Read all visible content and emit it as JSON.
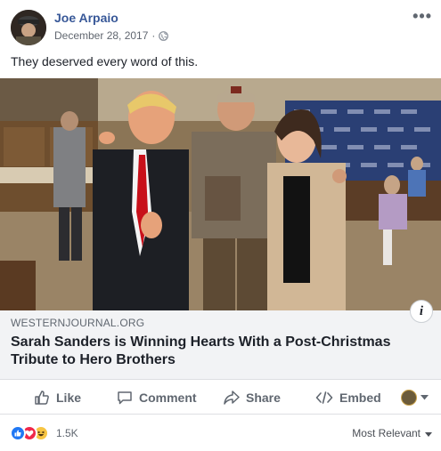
{
  "post": {
    "author": "Joe Arpaio",
    "date": "December 28, 2017",
    "separator": "·",
    "text": "They deserved every word of this.",
    "icons": {
      "more": "more-options-icon",
      "audience": "globe-icon"
    }
  },
  "link": {
    "domain": "WESTERNJOURNAL.ORG",
    "title": "Sarah Sanders is Winning Hearts With a Post-Christmas Tribute to Hero Brothers",
    "info_glyph": "i"
  },
  "actions": {
    "like": "Like",
    "comment": "Comment",
    "share": "Share",
    "embed": "Embed"
  },
  "footer": {
    "reaction_icons": [
      "like-reaction-icon",
      "love-reaction-icon",
      "haha-reaction-icon"
    ],
    "reaction_count": "1.5K",
    "sort_label": "Most Relevant"
  },
  "colors": {
    "link_blue": "#385898",
    "secondary_text": "#606770",
    "preview_bg": "#f2f3f5",
    "like_blue": "#2078f4",
    "love_red": "#f0284a",
    "haha_yellow": "#f7c543"
  }
}
